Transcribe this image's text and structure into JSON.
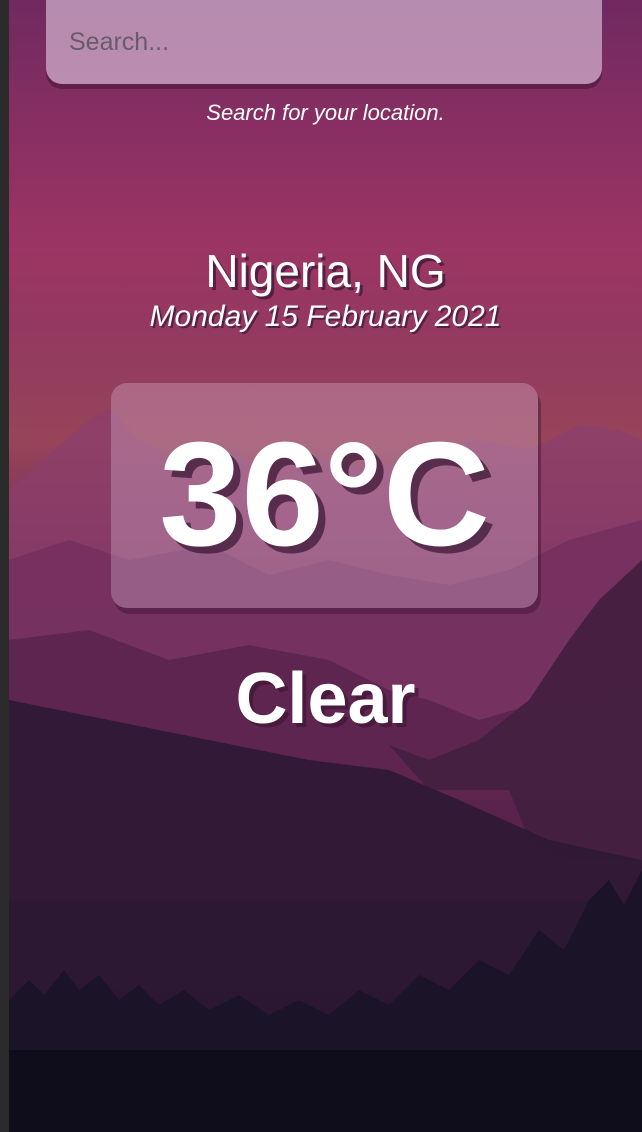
{
  "search": {
    "placeholder": "Search...",
    "hint": "Search for your location."
  },
  "weather": {
    "location": "Nigeria, NG",
    "date": "Monday 15 February 2021",
    "temperature": "36°C",
    "condition": "Clear"
  },
  "theme": {
    "text_color": "#ffffff",
    "sky_top": "#6f2a5f",
    "sky_glow": "#9b3563",
    "ground_dark": "#0f0d1b"
  }
}
